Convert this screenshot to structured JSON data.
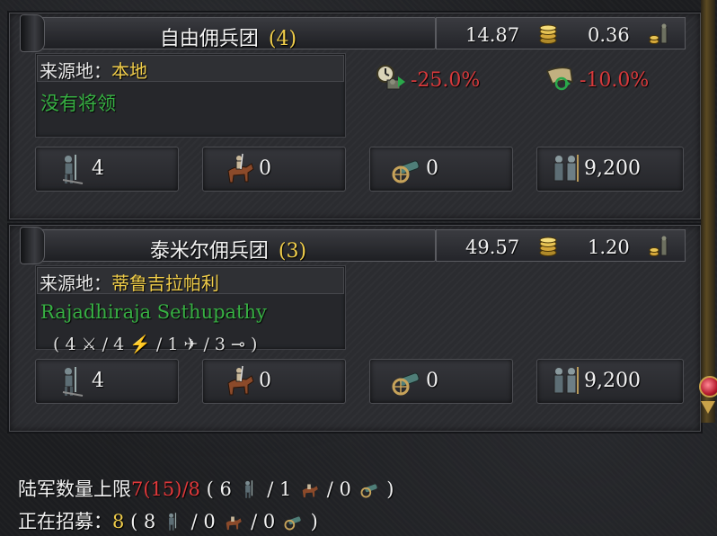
{
  "companies": [
    {
      "name": "自由佣兵团",
      "count": "(4)",
      "cost": "14.87",
      "upkeep": "0.36",
      "origin_label": "来源地：",
      "origin_value": "本地",
      "leader": "没有将领",
      "leader_stats": "",
      "mod_time": "-25.0%",
      "mod_morale": "-10.0%",
      "infantry": "4",
      "cavalry": "0",
      "artillery": "0",
      "manpower": "9,200"
    },
    {
      "name": "泰米尔佣兵团",
      "count": "(3)",
      "cost": "49.57",
      "upkeep": "1.20",
      "origin_label": "来源地：",
      "origin_value": "蒂鲁吉拉帕利",
      "leader": "Rajadhiraja Sethupathy",
      "leader_stats": "( 4 ⚔ / 4 ⚡ / 1 ✈ / 3 ⊸ )",
      "mod_time": "",
      "mod_morale": "",
      "infantry": "4",
      "cavalry": "0",
      "artillery": "0",
      "manpower": "9,200"
    }
  ],
  "footer": {
    "land_limit_label": "陆军数量上限",
    "land_limit_value": "7(15)/8",
    "land_open": "( 6",
    "land_sep1": "/ 1",
    "land_sep2": "/ 0",
    "land_close": ")",
    "recruiting_label": "正在招募：",
    "recruiting_value": "8",
    "rec_open": "( 8",
    "rec_sep1": "/ 0",
    "rec_sep2": "/ 0",
    "rec_close": ")"
  },
  "colors": {
    "gold": "#f0cd4a",
    "green": "#37b043",
    "red": "#d8393b"
  },
  "icons": [
    "coin-stack-icon",
    "upkeep-soldier-icon",
    "hourglass-time-icon",
    "horn-morale-icon",
    "infantry-icon",
    "cavalry-icon",
    "artillery-icon",
    "manpower-icon",
    "scroll-knob-icon"
  ]
}
